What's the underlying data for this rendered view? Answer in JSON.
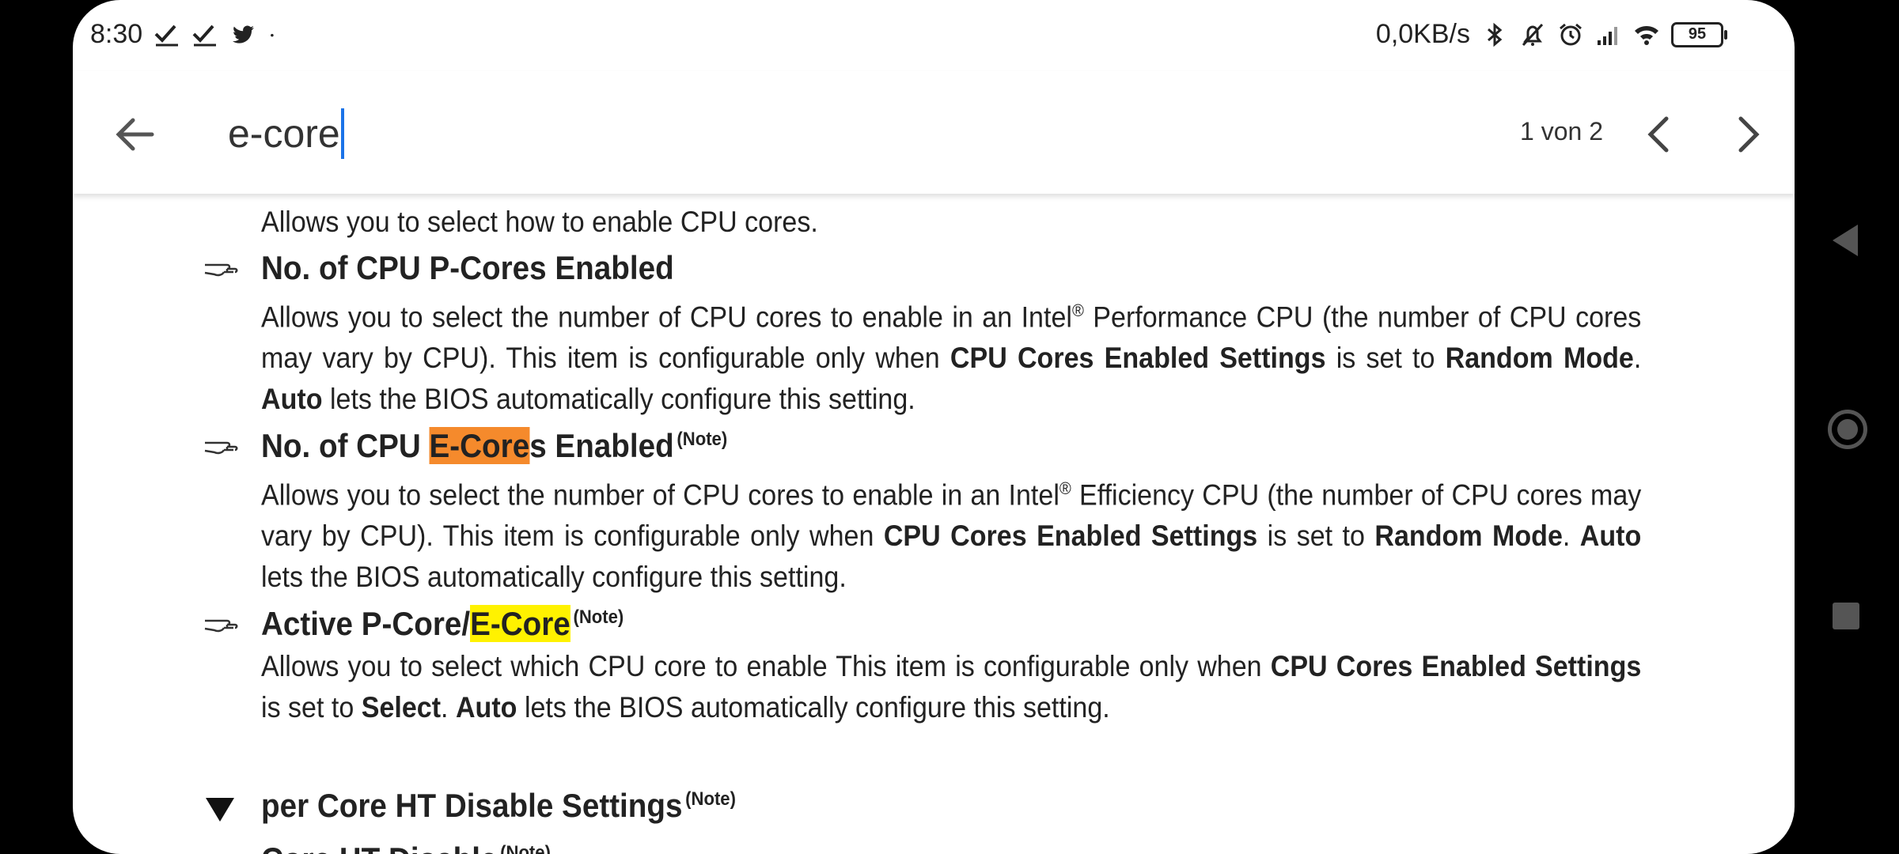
{
  "status_bar": {
    "time": "8:30",
    "left_icons": [
      "check-download-icon",
      "check-download-icon",
      "twitter-icon",
      "dot-icon"
    ],
    "net_speed": "0,0KB/s",
    "right_icons": [
      "bluetooth-icon",
      "bell-muted-icon",
      "alarm-icon",
      "signal-icon",
      "wifi-icon"
    ],
    "battery": "95"
  },
  "find_bar": {
    "query": "e-core",
    "match_count": "1 von 2"
  },
  "document": {
    "top_line": "Allows you to select how to enable CPU cores.",
    "items": [
      {
        "heading": "No. of CPU P-Cores Enabled",
        "p_parts": [
          "Allows you to select the number of CPU cores to enable in an Intel",
          "®",
          " Performance CPU (the number of CPU cores may vary by CPU). This item is configurable only when ",
          "CPU Cores Enabled Settings",
          " is set to ",
          "Random Mode",
          ". ",
          "Auto",
          " lets the BIOS automatically configure this setting."
        ]
      },
      {
        "heading_pre": "No. of CPU ",
        "heading_match": "E-Core",
        "heading_post": "s Enabled",
        "note": "(Note)",
        "p_parts": [
          "Allows you to select the number of CPU cores to enable in an Intel",
          "®",
          " Efficiency CPU (the number of CPU cores may vary by CPU). This item is configurable only when ",
          "CPU Cores Enabled Settings",
          " is set to ",
          "Random Mode",
          ". ",
          "Auto",
          " lets the BIOS automatically configure this setting."
        ]
      },
      {
        "heading_pre": "Active P-Core/",
        "heading_match": "E-Core",
        "note": "(Note)",
        "p_parts": [
          "Allows you to select which CPU core to enable This item is configurable only when ",
          "CPU Cores Enabled Settings",
          " is set to ",
          "Select",
          ". ",
          "Auto",
          " lets the BIOS automatically configure this setting."
        ]
      }
    ],
    "section": {
      "heading": "per Core HT Disable Settings",
      "note": "(Note)"
    },
    "bottom_item": {
      "heading": "Core HT Disable",
      "note": "(Note)"
    },
    "highlight_colors": {
      "current": "#f58a2c",
      "other": "#fff200"
    }
  }
}
